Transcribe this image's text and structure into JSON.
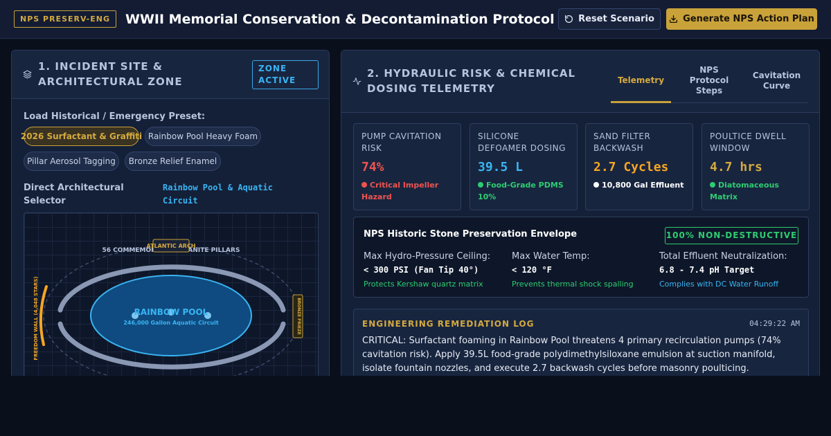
{
  "header": {
    "badge": "NPS PRESERV-ENG",
    "title": "WWII Memorial Conservation & Decontamination Protocol",
    "reset_label": "Reset Scenario",
    "plan_label": "Generate NPS Action Plan"
  },
  "left_panel": {
    "title": "1. INCIDENT SITE & ARCHITECTURAL ZONE",
    "status_badge": "ZONE ACTIVE",
    "preset_label": "Load Historical / Emergency Preset:",
    "presets": [
      {
        "label": "2026 Surfactant & Graffiti",
        "active": true
      },
      {
        "label": "Rainbow Pool Heavy Foam",
        "active": false
      },
      {
        "label": "Pillar Aerosol Tagging",
        "active": false
      },
      {
        "label": "Bronze Relief Enamel",
        "active": false
      }
    ],
    "selector_label": "Direct Architectural Selector",
    "selected_zone": "Rainbow Pool & Aquatic Circuit",
    "map": {
      "pillars_label": "56 COMMEMORATIVE GRANITE PILLARS",
      "arch_label": "ATLANTIC ARCH",
      "wall_label": "FREEDOM WALL (4,048 STARS)",
      "frieze_label": "BRONZE FRIEZE",
      "pool_label": "RAINBOW POOL",
      "pool_sublabel": "246,000 Gallon Aquatic Circuit"
    }
  },
  "right_panel": {
    "title": "2. HYDRAULIC RISK & CHEMICAL DOSING TELEMETRY",
    "tabs": [
      {
        "label": "Telemetry",
        "active": true
      },
      {
        "label": "NPS Protocol Steps",
        "active": false
      },
      {
        "label": "Cavitation Curve",
        "active": false
      }
    ],
    "metrics": [
      {
        "label": "PUMP CAVITATION RISK",
        "value": "74%",
        "note": "Critical Impeller Hazard",
        "color": "#ef5350",
        "dot": "#ef5350",
        "note_color": "#ef5350"
      },
      {
        "label": "SILICONE DEFOAMER DOSING",
        "value": "39.5 L",
        "note": "Food-Grade PDMS 10%",
        "color": "#3ab4f2",
        "dot": "#2ecc71",
        "note_color": "#2ecc71"
      },
      {
        "label": "SAND FILTER BACKWASH",
        "value": "2.7 Cycles",
        "note": "10,800 Gal Effluent",
        "color": "#f5a623",
        "dot": "#ffffff",
        "note_color": "#ffffff"
      },
      {
        "label": "POULTICE DWELL WINDOW",
        "value": "4.7 hrs",
        "note": "Diatomaceous Matrix",
        "color": "#d4aa40",
        "dot": "#2ecc71",
        "note_color": "#2ecc71"
      }
    ],
    "envelope": {
      "title": "NPS Historic Stone Preservation Envelope",
      "badge": "100% NON-DESTRUCTIVE",
      "columns": [
        {
          "label": "Max Hydro-Pressure Ceiling:",
          "value": "< 300 PSI (Fan Tip 40°)",
          "note": "Protects Kershaw quartz matrix",
          "note_color": "#2ecc71"
        },
        {
          "label": "Max Water Temp:",
          "value": "< 120 °F",
          "note": "Prevents thermal shock spalling",
          "note_color": "#2ecc71"
        },
        {
          "label": "Total Effluent Neutralization:",
          "value": "6.8 - 7.4 pH Target",
          "note": "Complies with DC Water Runoff",
          "note_color": "#3ab4f2"
        }
      ]
    },
    "log": {
      "title": "ENGINEERING REMEDIATION LOG",
      "time": "04:29:22 AM",
      "text": "CRITICAL: Surfactant foaming in Rainbow Pool threatens 4 primary recirculation pumps (74% cavitation risk). Apply 39.5L food-grade polydimethylsiloxane emulsion at suction manifold, isolate fountain nozzles, and execute 2.7 backwash cycles before masonry poulticing."
    }
  },
  "colors": {
    "accent_gold": "#c9a23a",
    "accent_blue": "#3ab4f2",
    "success_green": "#2ecc71",
    "danger_red": "#ef5350"
  }
}
